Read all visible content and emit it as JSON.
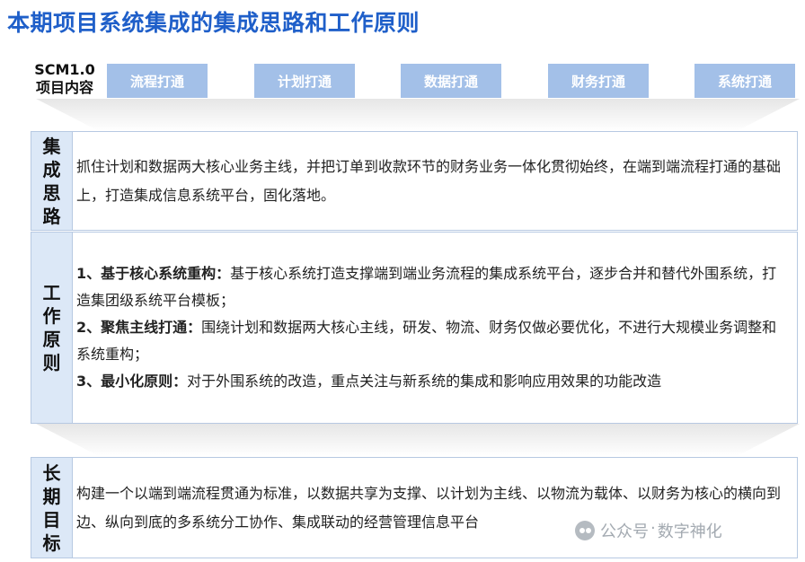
{
  "title": "本期项目系统集成的集成思路和工作原则",
  "scm": {
    "version": "SCM1.0",
    "label": "项目内容",
    "items": [
      "流程打通",
      "计划打通",
      "数据打通",
      "财务打通",
      "系统打通"
    ]
  },
  "idea": {
    "heading": "集成思路",
    "text": "抓住计划和数据两大核心业务主线，并把订单到收款环节的财务业务一体化贯彻始终，在端到端流程打通的基础上，打造集成信息系统平台，固化落地。"
  },
  "principles": {
    "heading": "工作原则",
    "items": [
      {
        "title": "1、基于核心系统重构：",
        "text": "基于核心系统打造支撑端到端业务流程的集成系统平台，逐步合并和替代外围系统，打造集团级系统平台模板；"
      },
      {
        "title": "2、聚焦主线打通：",
        "text": "围绕计划和数据两大核心主线，研发、物流、财务仅做必要优化，不进行大规模业务调整和系统重构；"
      },
      {
        "title": "3、最小化原则：",
        "text": "对于外围系统的改造，重点关注与新系统的集成和影响应用效果的功能改造"
      }
    ]
  },
  "goal": {
    "heading": "长期目标",
    "text": "构建一个以端到端流程贯通为标准，以数据共享为支撑、以计划为主线、以物流为载体、以财务为核心的横向到边、纵向到底的多系统分工协作、集成联动的经营管理信息平台"
  },
  "watermark": {
    "source": "公众号",
    "dot": "·",
    "name": "数字神化"
  },
  "colors": {
    "title": "#1f5fc9",
    "chip": "#a3c0e8",
    "side": "#dce8f7",
    "border": "#b7c9e2"
  }
}
